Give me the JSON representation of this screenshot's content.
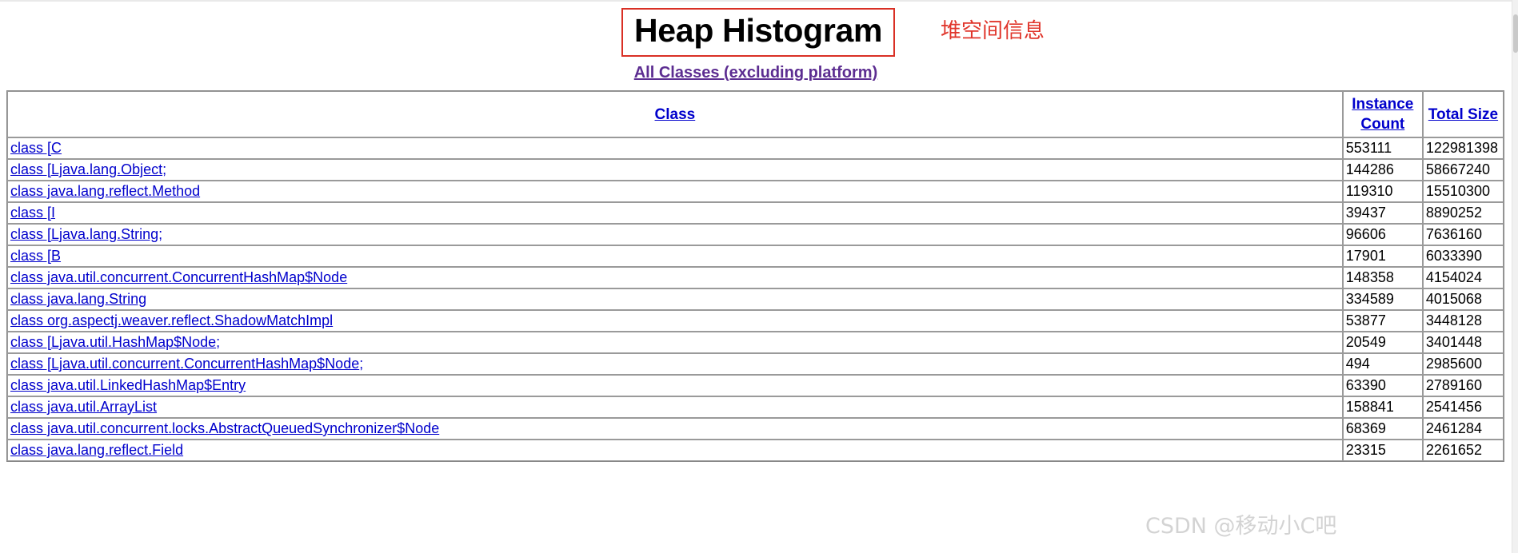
{
  "page": {
    "title": "Heap Histogram",
    "title_annotation": "堆空间信息",
    "subtitle_link": "All Classes (excluding platform)",
    "watermark": "CSDN @移动小C吧"
  },
  "colors": {
    "title_box_border": "#d93025",
    "annotation": "#e0352b",
    "visited_link": "#5c2d91",
    "link": "#0000cc",
    "text": "#000000",
    "background": "#ffffff",
    "table_border": "#9a9a9a"
  },
  "table": {
    "columns": [
      {
        "key": "class",
        "label": "Class",
        "is_link": true
      },
      {
        "key": "instance_count",
        "label": "Instance Count",
        "is_link": true
      },
      {
        "key": "total_size",
        "label": "Total Size",
        "is_link": true
      }
    ],
    "rows": [
      {
        "class": "class [C",
        "suffix": "",
        "instance_count": "553111",
        "total_size": "122981398"
      },
      {
        "class": "class [Ljava.lang.Object",
        "suffix": ";",
        "instance_count": "144286",
        "total_size": "58667240"
      },
      {
        "class": "class java.lang.reflect.Method",
        "suffix": "",
        "instance_count": "119310",
        "total_size": "15510300"
      },
      {
        "class": "class [I",
        "suffix": "",
        "instance_count": "39437",
        "total_size": "8890252"
      },
      {
        "class": "class [Ljava.lang.String",
        "suffix": ";",
        "instance_count": "96606",
        "total_size": "7636160"
      },
      {
        "class": "class [B",
        "suffix": "",
        "instance_count": "17901",
        "total_size": "6033390"
      },
      {
        "class": "class java.util.concurrent.ConcurrentHashMap$Node",
        "suffix": "",
        "instance_count": "148358",
        "total_size": "4154024"
      },
      {
        "class": "class java.lang.String",
        "suffix": "",
        "instance_count": "334589",
        "total_size": "4015068"
      },
      {
        "class": "class org.aspectj.weaver.reflect.ShadowMatchImpl",
        "suffix": "",
        "instance_count": "53877",
        "total_size": "3448128"
      },
      {
        "class": "class [Ljava.util.HashMap$Node",
        "suffix": ";",
        "instance_count": "20549",
        "total_size": "3401448"
      },
      {
        "class": "class [Ljava.util.concurrent.ConcurrentHashMap$Node",
        "suffix": ";",
        "instance_count": "494",
        "total_size": "2985600"
      },
      {
        "class": "class java.util.LinkedHashMap$Entry",
        "suffix": "",
        "instance_count": "63390",
        "total_size": "2789160"
      },
      {
        "class": "class java.util.ArrayList",
        "suffix": "",
        "instance_count": "158841",
        "total_size": "2541456"
      },
      {
        "class": "class java.util.concurrent.locks.AbstractQueuedSynchronizer$Node",
        "suffix": "",
        "instance_count": "68369",
        "total_size": "2461284"
      },
      {
        "class": "class java.lang.reflect.Field",
        "suffix": "",
        "instance_count": "23315",
        "total_size": "2261652"
      }
    ]
  }
}
